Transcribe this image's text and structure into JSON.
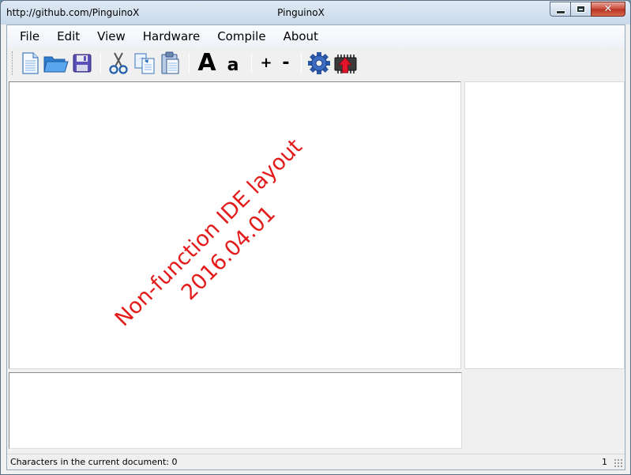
{
  "window": {
    "title_left": "http://github.com/PinguinoX",
    "title": "PinguinoX",
    "minimize_glyph": "",
    "maximize_glyph": "",
    "close_glyph": "✕"
  },
  "menu": {
    "items": [
      {
        "label": "File"
      },
      {
        "label": "Edit"
      },
      {
        "label": "View"
      },
      {
        "label": "Hardware"
      },
      {
        "label": "Compile"
      },
      {
        "label": "About"
      }
    ]
  },
  "toolbar": {
    "font_increase_label": "A",
    "font_decrease_label": "a",
    "zoom_in_label": "+",
    "zoom_out_label": "-",
    "icons": [
      "new-document-icon",
      "open-folder-icon",
      "save-icon",
      "cut-icon",
      "copy-icon",
      "paste-icon",
      "gear-icon",
      "upload-chip-icon"
    ]
  },
  "editor": {
    "watermark_line1": "Non-function IDE layout",
    "watermark_line2": "2016.04.01"
  },
  "statusbar": {
    "text": "Characters in the current document: 0",
    "line": "1"
  },
  "colors": {
    "watermark": "#e31b1b",
    "close_button": "#c8483a"
  }
}
